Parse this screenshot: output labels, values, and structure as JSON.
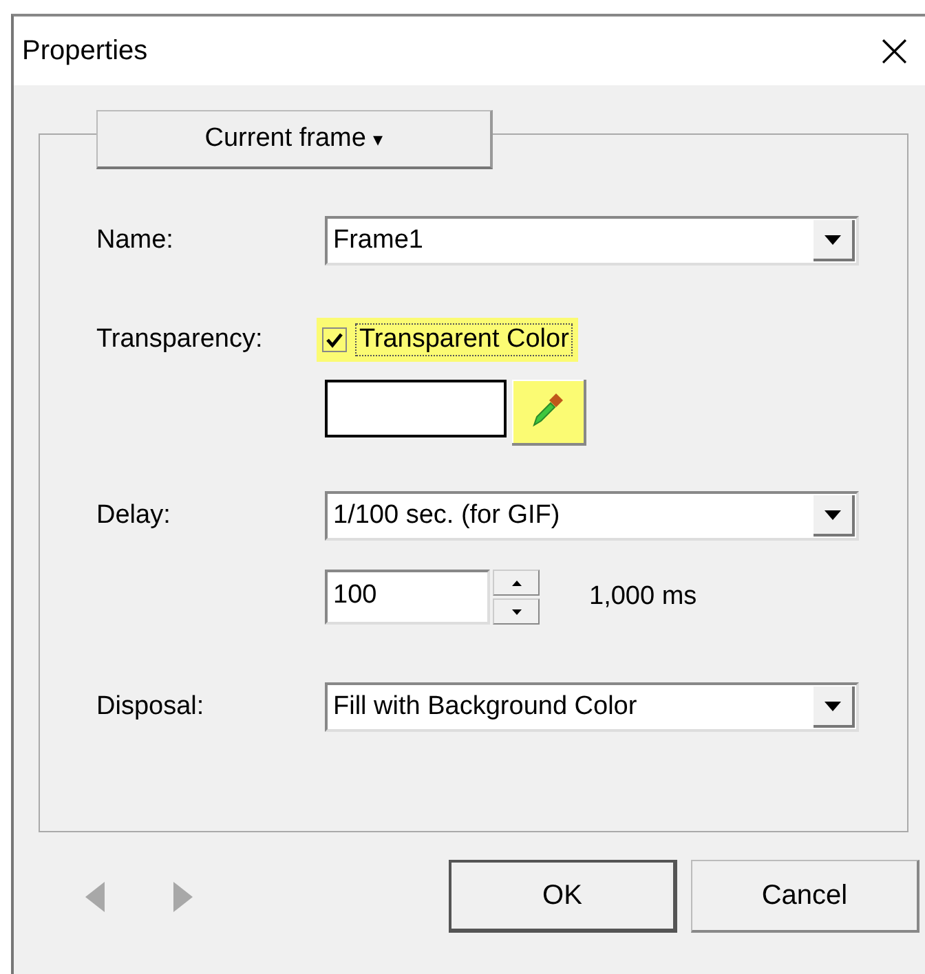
{
  "window": {
    "title": "Properties",
    "close": "×"
  },
  "mode_button": {
    "label": "Current frame",
    "caret": "▾"
  },
  "fields": [
    {
      "kind": "combo",
      "label": "Name:",
      "value": "Frame1"
    },
    {
      "kind": "transparency",
      "label": "Transparency:",
      "checkbox": {
        "label": "Transparent Color",
        "checked": true,
        "highlighted": true
      },
      "picker": {
        "highlighted": true
      }
    },
    {
      "kind": "combo",
      "label": "Delay:",
      "value": "1/100 sec. (for GIF)"
    },
    {
      "kind": "spin",
      "value": "100",
      "reading": "1,000 ms"
    },
    {
      "kind": "combo",
      "label": "Disposal:",
      "value": "Fill with Background Color"
    }
  ],
  "nav": {
    "previous_disabled": true,
    "next_disabled": true
  },
  "buttons": [
    {
      "label": "OK",
      "default": true
    },
    {
      "label": "Cancel",
      "default": false
    }
  ]
}
